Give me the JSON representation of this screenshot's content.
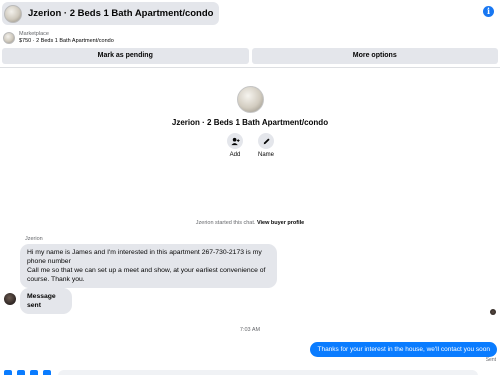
{
  "header": {
    "title": "Jzerion · 2 Beds 1 Bath Apartment/condo",
    "info_icon": "i"
  },
  "marketplace": {
    "label": "Marketplace",
    "item": "$750 · 2 Beds 1 Bath Apartment/condo"
  },
  "actions": {
    "mark_pending": "Mark as pending",
    "more_options": "More options"
  },
  "profile": {
    "name": "Jzerion · 2 Beds 1 Bath Apartment/condo",
    "add_label": "Add",
    "name_label": "Name"
  },
  "chat": {
    "started_text": "Jzerion started this chat.",
    "view_buyer_profile": "View buyer profile",
    "sender_name": "Jzerion",
    "message_1_line_1": "Hi my name is James and I'm interested in this apartment 267-730-2173 is my phone number",
    "message_1_line_2": "Call me so that we can set up a meet and show, at your earliest convenience of course. Thank you.",
    "message_2": "Message sent",
    "timestamp": "7:03 AM",
    "reply": "Thanks for your interest in the house, we'll contact you soon",
    "status": "Sent"
  },
  "colors": {
    "accent": "#0a7cff",
    "bubble_gray": "#e4e6eb"
  }
}
